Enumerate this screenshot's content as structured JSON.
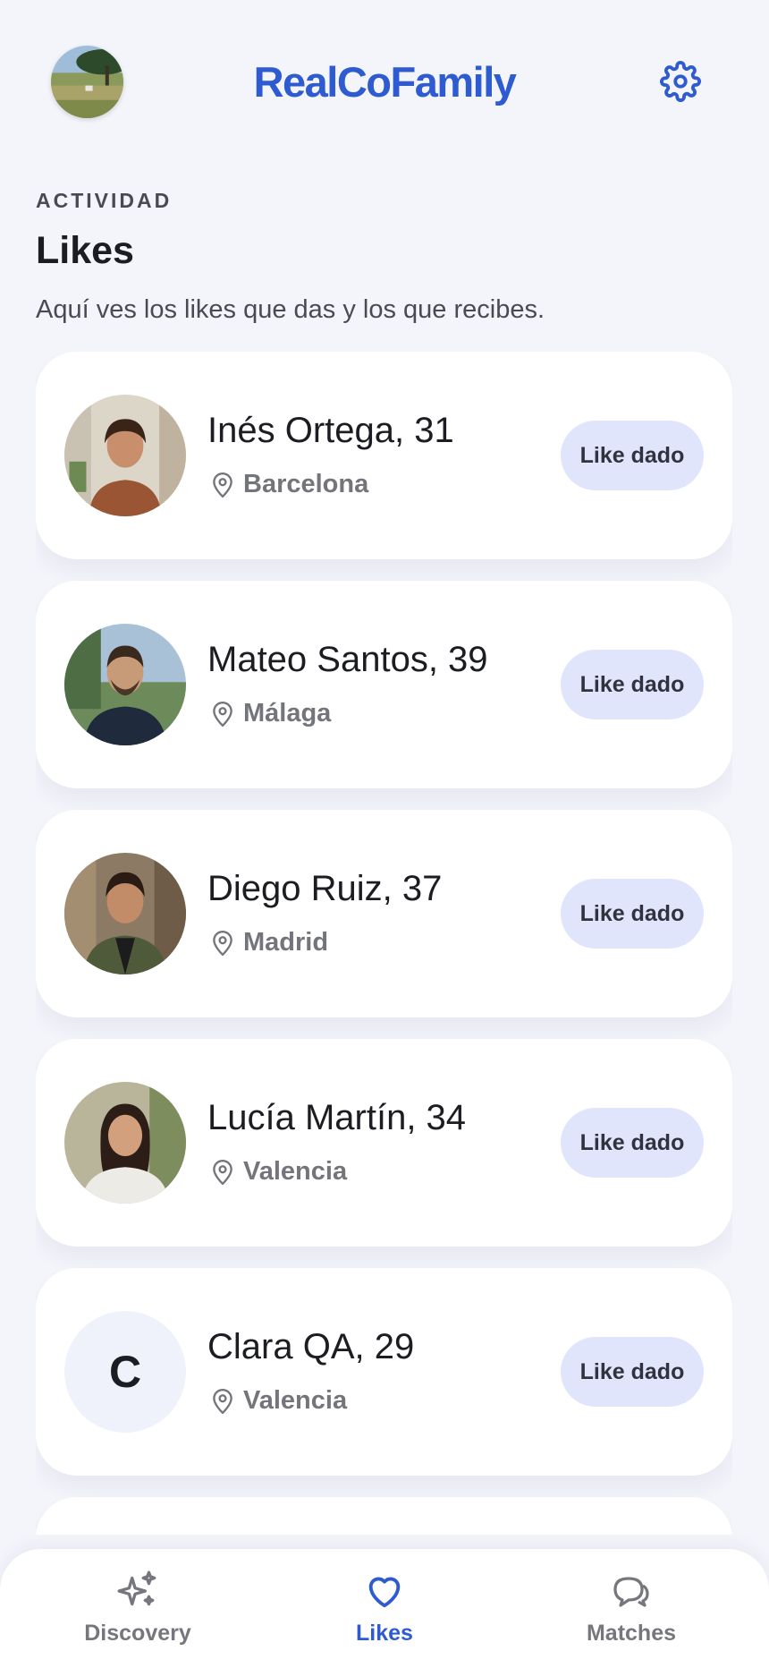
{
  "header": {
    "brand": "RealCoFamily"
  },
  "section": {
    "eyebrow": "ACTIVIDAD",
    "title": "Likes",
    "subtitle": "Aquí ves los likes que das y los que recibes."
  },
  "likes": [
    {
      "name": "Inés Ortega, 31",
      "location": "Barcelona",
      "status": "Like dado"
    },
    {
      "name": "Mateo Santos, 39",
      "location": "Málaga",
      "status": "Like dado"
    },
    {
      "name": "Diego Ruiz, 37",
      "location": "Madrid",
      "status": "Like dado"
    },
    {
      "name": "Lucía Martín, 34",
      "location": "Valencia",
      "status": "Like dado"
    },
    {
      "name": "Clara QA, 29",
      "location": "Valencia",
      "status": "Like dado",
      "initial": "C"
    }
  ],
  "nav": {
    "items": [
      {
        "label": "Discovery",
        "icon": "sparkles-icon"
      },
      {
        "label": "Likes",
        "icon": "heart-icon",
        "active": true
      },
      {
        "label": "Matches",
        "icon": "chat-bubbles-icon"
      }
    ]
  },
  "colors": {
    "brand": "#2f5bd0",
    "background": "#f4f5fb",
    "pill": "#e1e5fb"
  }
}
